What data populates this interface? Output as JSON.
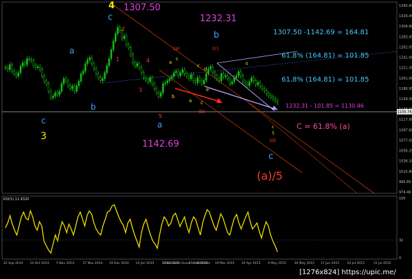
{
  "colors": {
    "background": "#000000",
    "candle": "#16c016",
    "rsi_line": "#f0e000",
    "grid": "#555555",
    "price_line": "#c0c0c0",
    "yellow": "#f5e400",
    "blue": "#3a9cff",
    "red": "#ff3b30",
    "magenta": "#e040e0",
    "pink": "#ff4aa0",
    "cyan": "#49c8ff",
    "orange_line": "#c84010",
    "lavender": "#b0a0ff",
    "white": "#ffffff"
  },
  "labels": {
    "top_4": "4",
    "top_c": "c",
    "top_price": "1307.50",
    "top_red_2": "2",
    "top_red_1": "1",
    "top_red_4": "4",
    "top_red_3": "3",
    "left_a": "a",
    "left_b": "b",
    "left_c": "c",
    "left_3": "3",
    "mid_red_5": "5",
    "mid_a": "a",
    "low_price": "1142.69",
    "b_price": "1232.31",
    "b_label": "b",
    "paren_a": "(a)",
    "paren_c": "(c)",
    "paren_b": "(b)",
    "paren_d": "(d)",
    "small_a": "a",
    "small_c": "c",
    "small_b": "b",
    "small_c2": "c",
    "small_d": "d",
    "small_e": "e",
    "small_a2": "a",
    "small_c3": "c",
    "small_4": "4",
    "small_5": "5",
    "small_c4": "c",
    "final_c": "c",
    "final_a5": "(a)/5",
    "calc1": "1307.50 -1142.69 = 164.81",
    "calc2": "61.8% (164.81) = 101.85",
    "calc3": "61.8% (164.81) = 101.85",
    "calc4": "1232.31 - 101.85 = 1130.46",
    "calc5": "C = 61.8% (a)",
    "rsi_label": "RSI(5) 11.4320",
    "rsi_top": "100",
    "rsi_32": "32",
    "rsi_0": "0",
    "watermark": "[1276x824] https://upic.me/",
    "bottom_center": "GOLD Gold Ounce vs US Dollar"
  },
  "chart_data": {
    "type": "line",
    "title": "",
    "price_axis_ticks": [
      "1345.85",
      "1326.45",
      "1304.80",
      "1283.45",
      "1262.05",
      "1241.00",
      "1221.30",
      "1201.00",
      "1180.95",
      "1159.30",
      "1138.00",
      "1117.95",
      "1097.60",
      "1077.05",
      "1056.25",
      "1036.10",
      "1015.80",
      "995.85",
      "974.46"
    ],
    "current_price_label": "1155.75",
    "rsi_axis_ticks": [
      "100",
      "32",
      "0"
    ],
    "date_ticks": [
      "22 Sep 2014",
      "14 Oct 2014",
      "5 Nov 2014",
      "27 Nov 2014",
      "19 Dec 2014",
      "14 Jan 2015",
      "5 Feb 2015",
      "27 Feb 2015",
      "19 Mar 2015",
      "10 Apr 2015",
      "4 May 2015",
      "26 May 2015",
      "17 Jun 2015",
      "10 Jul 2015",
      "31 Jul 2015"
    ],
    "price_series": [
      1222,
      1218,
      1228,
      1215,
      1210,
      1205,
      1212,
      1225,
      1232,
      1228,
      1240,
      1238,
      1236,
      1226,
      1222,
      1224,
      1218,
      1205,
      1195,
      1190,
      1175,
      1162,
      1165,
      1172,
      1168,
      1175,
      1190,
      1200,
      1195,
      1186,
      1180,
      1185,
      1175,
      1186,
      1195,
      1210,
      1215,
      1230,
      1238,
      1242,
      1230,
      1220,
      1210,
      1202,
      1196,
      1200,
      1212,
      1226,
      1240,
      1258,
      1275,
      1290,
      1302,
      1296,
      1280,
      1285,
      1268,
      1262,
      1248,
      1232,
      1225,
      1230,
      1222,
      1212,
      1202,
      1198,
      1194,
      1202,
      1190,
      1180,
      1172,
      1165,
      1172,
      1190,
      1192,
      1196,
      1200,
      1204,
      1212,
      1215,
      1206,
      1212,
      1218,
      1210,
      1205,
      1200,
      1208,
      1196,
      1192,
      1202,
      1196,
      1190,
      1197,
      1210,
      1220,
      1224,
      1212,
      1206,
      1200,
      1196,
      1210,
      1204,
      1206,
      1200,
      1190,
      1194,
      1202,
      1206,
      1214,
      1206,
      1194,
      1190,
      1186,
      1194,
      1202,
      1196,
      1188,
      1192,
      1184,
      1180,
      1176,
      1170,
      1166,
      1164,
      1160,
      1156,
      1152
    ],
    "rsi_series": [
      52,
      60,
      72,
      58,
      48,
      40,
      55,
      70,
      78,
      68,
      65,
      80,
      70,
      55,
      48,
      62,
      55,
      30,
      22,
      15,
      10,
      25,
      40,
      30,
      48,
      62,
      55,
      44,
      58,
      50,
      40,
      55,
      70,
      78,
      66,
      55,
      72,
      80,
      75,
      60,
      50,
      44,
      40,
      55,
      66,
      78,
      80,
      88,
      90,
      80,
      70,
      62,
      56,
      44,
      60,
      66,
      52,
      40,
      30,
      20,
      44,
      58,
      66,
      52,
      40,
      30,
      25,
      18,
      40,
      58,
      70,
      65,
      55,
      60,
      72,
      76,
      66,
      54,
      62,
      70,
      55,
      44,
      60,
      70,
      65,
      52,
      40,
      60,
      72,
      82,
      78,
      66,
      55,
      48,
      62,
      75,
      68,
      56,
      44,
      40,
      55,
      68,
      74,
      60,
      50,
      60,
      70,
      78,
      62,
      50,
      55,
      60,
      46,
      35,
      50,
      62,
      55,
      40,
      30,
      22,
      12
    ],
    "annotations": [
      {
        "text": "1307.50 -1142.69 = 164.81"
      },
      {
        "text": "61.8% (164.81) = 101.85"
      },
      {
        "text": "61.8% (164.81) = 101.85"
      },
      {
        "text": "1232.31 - 101.85 = 1130.46"
      },
      {
        "text": "C = 61.8% (a)"
      }
    ]
  }
}
